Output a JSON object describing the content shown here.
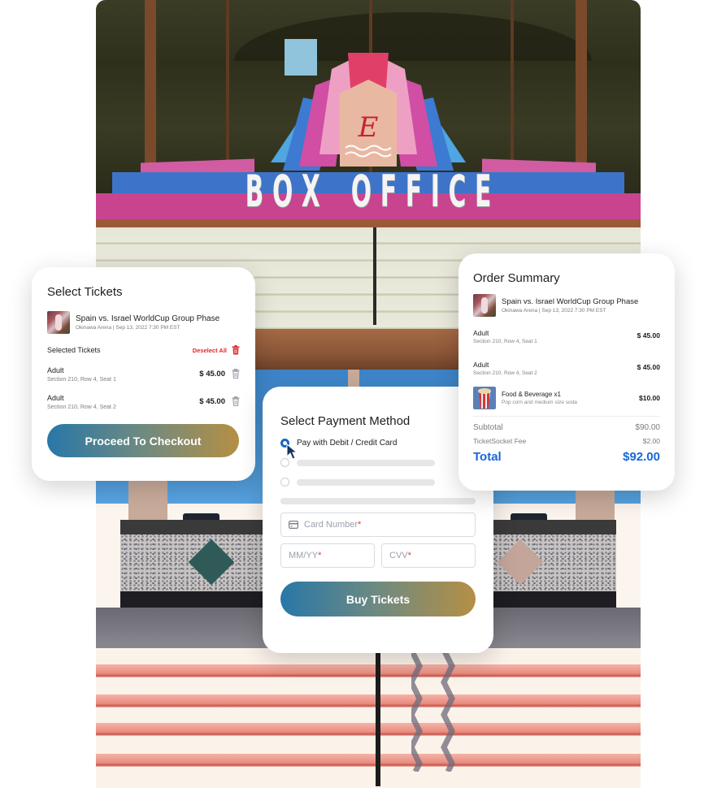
{
  "background_photo": {
    "description": "Theater box office facade with neon art-deco marquee",
    "marquee_text": [
      "B",
      "O",
      "X",
      "O",
      "F",
      "F",
      "I",
      "C",
      "E"
    ],
    "emblem_letter": "E"
  },
  "colors": {
    "button_gradient": [
      "#2877a8",
      "#6f8a80",
      "#b58f44"
    ],
    "danger": "#e0272d",
    "accent_blue": "#1768d6",
    "radio_selected": "#1565c8"
  },
  "event": {
    "name": "Spain vs. Israel WorldCup Group Phase",
    "details": "Okinawa Arena | Sep 13, 2022 7:30  PM EST",
    "thumbnail_icon": "event-photo"
  },
  "select_tickets": {
    "title": "Select Tickets",
    "selected_label": "Selected Tickets",
    "deselect_label": "Deselect All",
    "tickets": [
      {
        "type": "Adult",
        "seat": "Section 210, Row 4, Seat 1",
        "price": "$ 45.00"
      },
      {
        "type": "Adult",
        "seat": "Section 210, Row 4, Seat 2",
        "price": "$ 45.00"
      }
    ],
    "checkout_label": "Proceed To Checkout"
  },
  "payment": {
    "title": "Select Payment Method",
    "options": [
      {
        "label": "Pay with Debit / Credit Card",
        "selected": true
      },
      {
        "label": "",
        "selected": false
      },
      {
        "label": "",
        "selected": false
      }
    ],
    "card_number_placeholder": "Card Number",
    "expiry_placeholder": "MM/YY",
    "cvv_placeholder": "CVV",
    "required_mark": "*",
    "buy_label": "Buy Tickets"
  },
  "order_summary": {
    "title": "Order Summary",
    "items": [
      {
        "type": "Adult",
        "seat": "Section 210, Row 4, Seat 1",
        "price": "$ 45.00"
      },
      {
        "type": "Adult",
        "seat": "Section 210, Row 4, Seat 2",
        "price": "$ 45.00"
      }
    ],
    "food": {
      "name": "Food & Beverage x1",
      "desc": "Pop corn and medium size soda",
      "price": "$10.00"
    },
    "subtotal_label": "Subtotal",
    "subtotal_value": "$90.00",
    "fee_label": "TicketSocket Fee",
    "fee_value": "$2.00",
    "total_label": "Total",
    "total_value": "$92.00"
  }
}
